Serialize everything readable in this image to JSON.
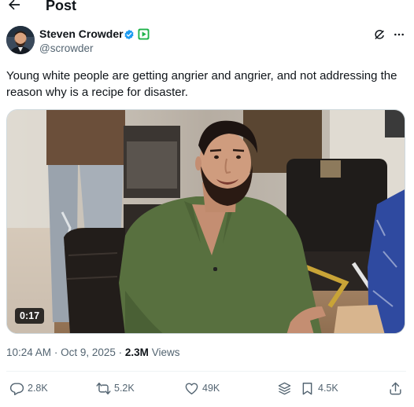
{
  "header": {
    "title": "Post",
    "back_icon": "arrow-left-icon"
  },
  "author": {
    "display_name": "Steven Crowder",
    "handle": "@scrowder",
    "verified_badge_color": "#1d9bf0",
    "affiliate_badge_color": "#1fb34a"
  },
  "tweet": {
    "text": "Young white people are getting angrier and angrier, and not addressing the reason why is a recipe for disaster."
  },
  "media": {
    "type": "video",
    "duration": "0:17"
  },
  "meta": {
    "time": "10:24 AM",
    "separator": "·",
    "date": "Oct 9, 2025",
    "views_count": "2.3M",
    "views_label": "Views"
  },
  "actions": {
    "replies": "2.8K",
    "reposts": "5.2K",
    "likes": "49K",
    "bookmarks": "4.5K"
  },
  "colors": {
    "text": "#0f1419",
    "secondary": "#536471",
    "accent": "#1d9bf0"
  }
}
